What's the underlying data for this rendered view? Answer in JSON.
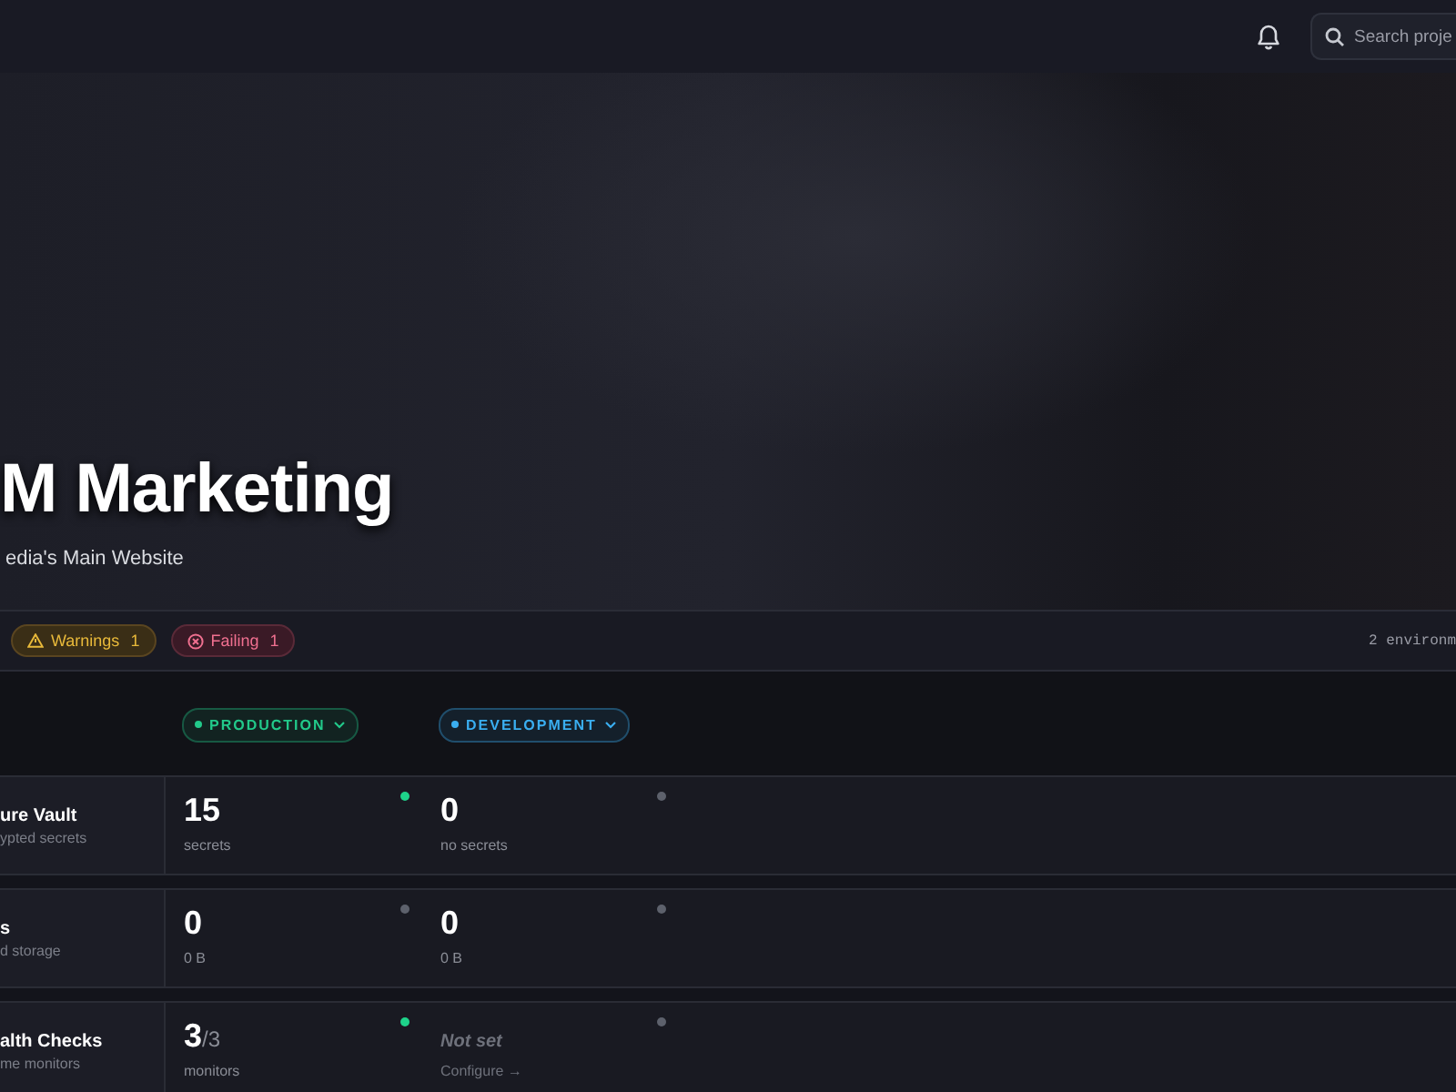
{
  "topbar": {
    "search": {
      "placeholder": "Search proje"
    }
  },
  "hero": {
    "title": "M Marketing",
    "subtitle": "edia's Main Website"
  },
  "status_row": {
    "badges": [
      {
        "kind": "warning",
        "label": "Warnings",
        "count": "1"
      },
      {
        "kind": "failing",
        "label": "Failing",
        "count": "1"
      }
    ],
    "summary": "2 environm"
  },
  "environments": [
    {
      "label": "PRODUCTION",
      "color": "#22c98a"
    },
    {
      "label": "DEVELOPMENT",
      "color": "#3aaef0"
    }
  ],
  "rows": [
    {
      "title": "ure Vault",
      "subtitle": "ypted secrets",
      "cells": [
        {
          "kind": "count",
          "value": "15",
          "caption": "secrets",
          "color": "#1ed38a"
        },
        {
          "kind": "count",
          "value": "0",
          "caption": "no secrets",
          "color": "#5d616c"
        }
      ]
    },
    {
      "title": "s",
      "subtitle": "d storage",
      "cells": [
        {
          "kind": "count",
          "value": "0",
          "caption": "0 B",
          "color": "#5d616c"
        },
        {
          "kind": "count",
          "value": "0",
          "caption": "0 B",
          "color": "#5d616c"
        }
      ]
    },
    {
      "title": "alth Checks",
      "subtitle": "me monitors",
      "cells": [
        {
          "kind": "count",
          "value": "3",
          "total": "/3",
          "caption": "monitors",
          "color": "#1ed38a"
        },
        {
          "kind": "unset",
          "value": "Not set",
          "link": "Configure →",
          "color": "#5d616c"
        }
      ]
    }
  ]
}
